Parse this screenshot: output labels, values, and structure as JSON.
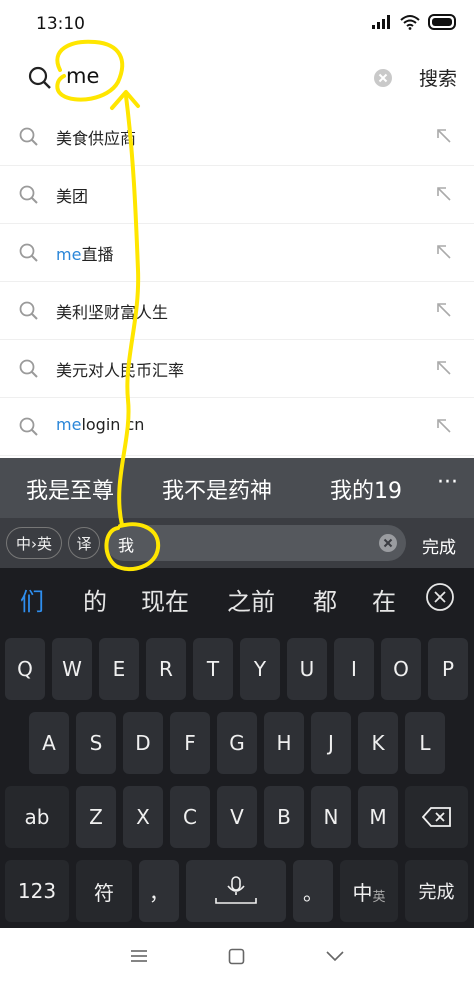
{
  "status": {
    "time": "13:10"
  },
  "search": {
    "query": "me",
    "action_label": "搜索"
  },
  "suggestions": [
    {
      "hl": "",
      "rest": "美食供应商"
    },
    {
      "hl": "",
      "rest": "美团"
    },
    {
      "hl": "me",
      "rest": "直播"
    },
    {
      "hl": "",
      "rest": "美利坚财富人生"
    },
    {
      "hl": "",
      "rest": "美元对人民币汇率"
    },
    {
      "hl": "me",
      "rest": "login cn"
    }
  ],
  "candidates": [
    "我是至尊",
    "我不是药神",
    "我的19"
  ],
  "candidates_more": "···",
  "input_line": {
    "lang_toggle": "中›英",
    "translate": "译",
    "composing": "我",
    "done_label": "完成"
  },
  "pinyin_candidates": [
    "们",
    "的",
    "现在",
    "之前",
    "都",
    "在"
  ],
  "rows": {
    "row1": [
      "Q",
      "W",
      "E",
      "R",
      "T",
      "Y",
      "U",
      "I",
      "O",
      "P"
    ],
    "row2": [
      "A",
      "S",
      "D",
      "F",
      "G",
      "H",
      "J",
      "K",
      "L"
    ],
    "row3": [
      "Z",
      "X",
      "C",
      "V",
      "B",
      "N",
      "M"
    ]
  },
  "keys": {
    "shift": "ab",
    "numbers": "123",
    "symbols": "符",
    "comma": "，",
    "period": "。",
    "lang_main": "中",
    "lang_sub": "英",
    "done": "完成"
  },
  "colors": {
    "accent": "#2f8ff0",
    "highlight": "#2a86d8",
    "annotation": "#ffe600",
    "keyboard_bg": "#1c1d21"
  }
}
